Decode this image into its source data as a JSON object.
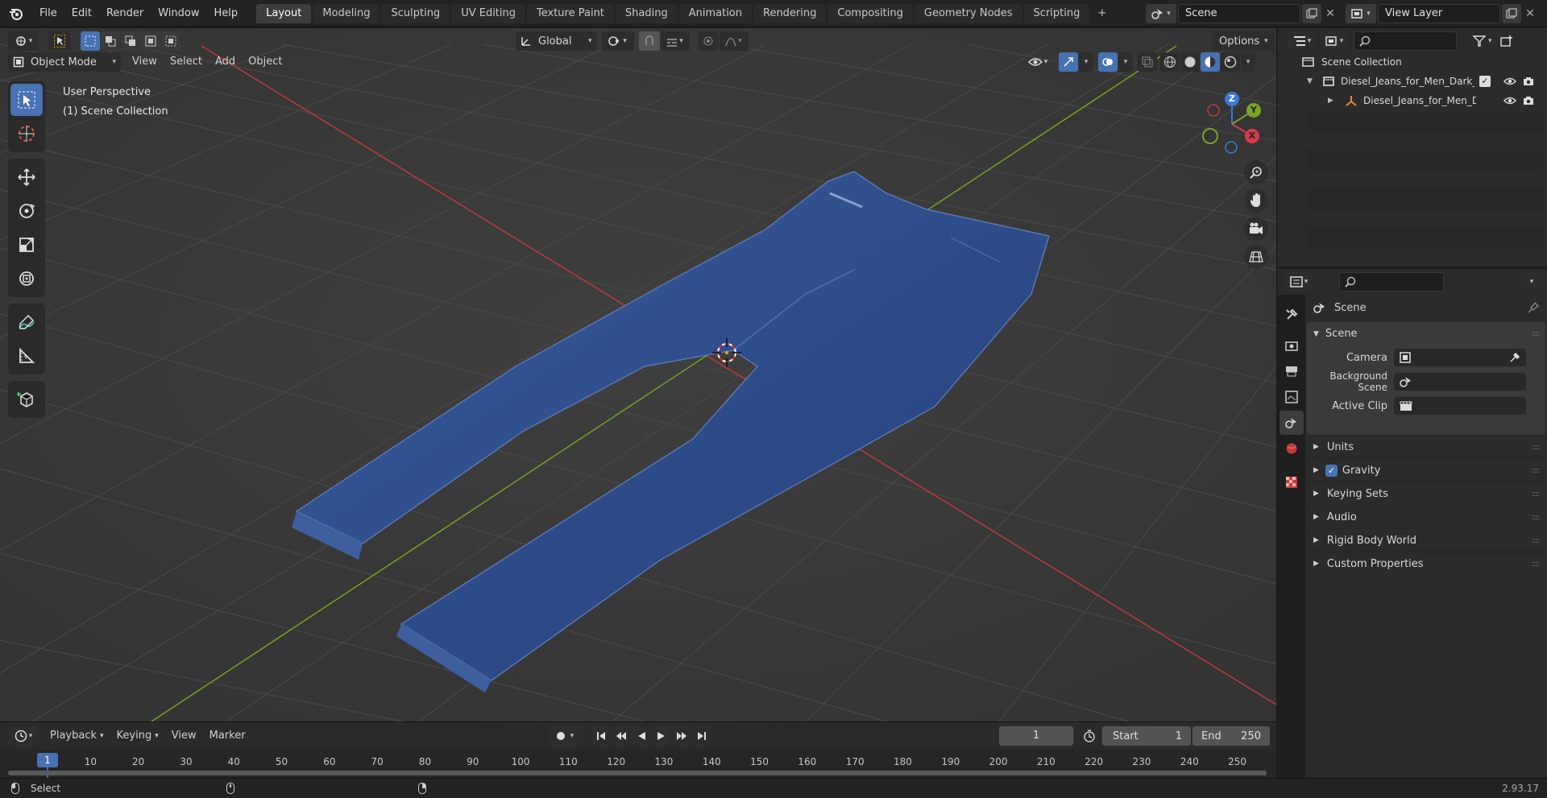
{
  "topbar": {
    "menus": [
      "File",
      "Edit",
      "Render",
      "Window",
      "Help"
    ],
    "workspaces": [
      "Layout",
      "Modeling",
      "Sculpting",
      "UV Editing",
      "Texture Paint",
      "Shading",
      "Animation",
      "Rendering",
      "Compositing",
      "Geometry Nodes",
      "Scripting"
    ],
    "active_workspace": "Layout",
    "add_tab_label": "+",
    "scene_name": "Scene",
    "view_layer_name": "View Layer"
  },
  "viewport": {
    "mode": "Object Mode",
    "menus": [
      "View",
      "Select",
      "Add",
      "Object"
    ],
    "transform_orientation": "Global",
    "options_label": "Options",
    "overlay_title": "User Perspective",
    "overlay_subtitle": "(1) Scene Collection",
    "gizmo_axes": {
      "x": "X",
      "y": "Y",
      "z": "Z"
    },
    "colors": {
      "x_axis": "#c03a3a",
      "y_axis": "#7aa328",
      "grid": "#454545",
      "denim": "#2c4b86"
    }
  },
  "timeline": {
    "menus": [
      "Playback",
      "Keying",
      "View",
      "Marker"
    ],
    "current_frame": "1",
    "start_label": "Start",
    "start_value": "1",
    "end_label": "End",
    "end_value": "250",
    "ticks": [
      "1",
      "10",
      "20",
      "30",
      "40",
      "50",
      "60",
      "70",
      "80",
      "90",
      "100",
      "110",
      "120",
      "130",
      "140",
      "150",
      "160",
      "170",
      "180",
      "190",
      "200",
      "210",
      "220",
      "230",
      "240",
      "250"
    ]
  },
  "statusbar": {
    "left_label": "Select",
    "version": "2.93.17"
  },
  "outliner": {
    "root": "Scene Collection",
    "collection": "Diesel_Jeans_for_Men_Dark_B",
    "object": "Diesel_Jeans_for_Men_Da"
  },
  "properties": {
    "context": "Scene",
    "section_title": "Scene",
    "fields": {
      "camera_label": "Camera",
      "background_scene_label": "Background Scene",
      "active_clip_label": "Active Clip"
    },
    "panels": [
      "Units",
      "Gravity",
      "Keying Sets",
      "Audio",
      "Rigid Body World",
      "Custom Properties"
    ],
    "gravity_checked": true
  }
}
